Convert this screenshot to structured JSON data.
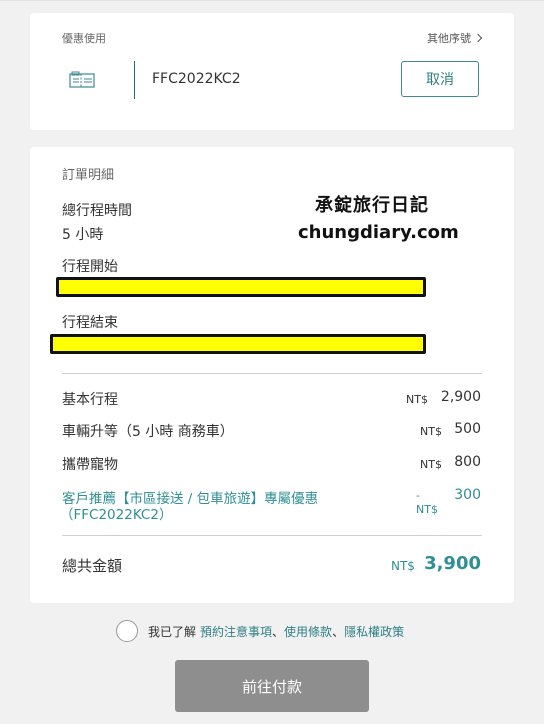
{
  "coupon": {
    "section_label": "優惠使用",
    "other_link": "其他序號",
    "code": "FFC2022KC2",
    "cancel_label": "取消"
  },
  "watermark": {
    "title": "承錠旅行日記",
    "url": "chungdiary.com"
  },
  "order": {
    "section_label": "訂單明細",
    "duration_label": "總行程時間",
    "duration_value": "5 小時",
    "start_label": "行程開始",
    "end_label": "行程結束",
    "line_items": [
      {
        "label": "基本行程",
        "currency": "NT$",
        "amount": "2,900"
      },
      {
        "label": "車輛升等（5 小時 商務車）",
        "currency": "NT$",
        "amount": "500"
      },
      {
        "label": "攜帶寵物",
        "currency": "NT$",
        "amount": "800"
      }
    ],
    "promo": {
      "label_line1": "客戶推薦【市區接送 / 包車旅遊】專屬優惠",
      "label_line2": "（FFC2022KC2）",
      "sign": "-",
      "currency": "NT$",
      "amount": "300"
    },
    "total_label": "總共金額",
    "total_currency": "NT$",
    "total_amount": "3,900"
  },
  "agreement": {
    "prefix": "我已了解",
    "link1": "預約注意事項",
    "sep1": "、",
    "link2": "使用條款",
    "sep2": "、",
    "link3": "隱私權政策"
  },
  "pay_button_label": "前往付款",
  "colors": {
    "accent": "#2f8f94",
    "redaction_fill": "#ffff00",
    "pay_button": "#8e8e8e"
  }
}
